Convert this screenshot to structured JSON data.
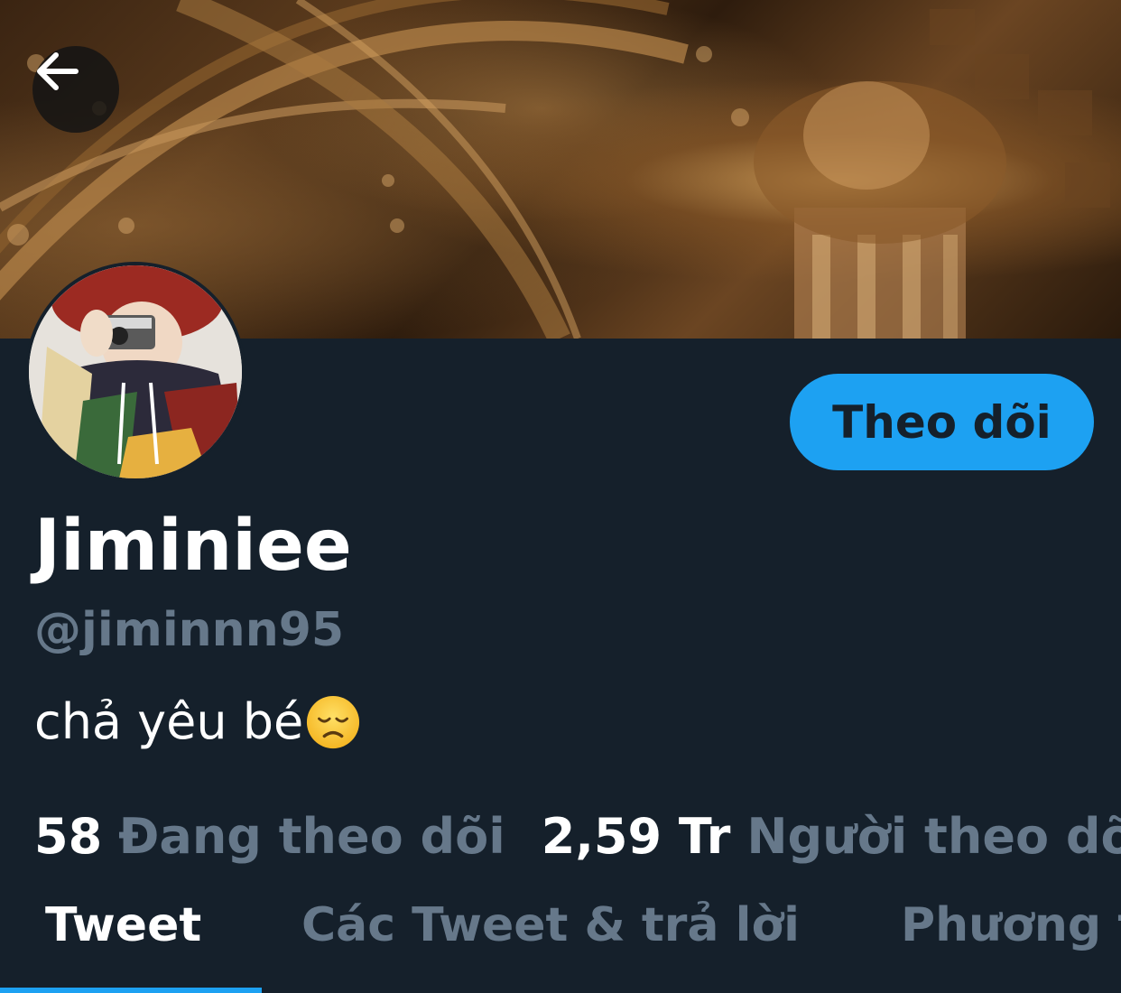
{
  "header": {
    "back_icon": "arrow-left-icon"
  },
  "profile": {
    "display_name": "Jiminiee",
    "handle": "@jiminnn95",
    "bio": "chả yêu bé",
    "bio_emoji": "disappointed-face-emoji",
    "follow_button_label": "Theo dõi"
  },
  "stats": {
    "following_count": "58",
    "following_label": "Đang theo dõi",
    "followers_count": "2,59 Tr",
    "followers_label": "Người theo dõi"
  },
  "tabs": [
    {
      "label": "Tweet",
      "active": true
    },
    {
      "label": "Các Tweet & trả lời",
      "active": false
    },
    {
      "label": "Phương tiện",
      "active": false
    }
  ],
  "colors": {
    "background": "#15202b",
    "accent": "#1da1f2",
    "secondary_text": "#66788a",
    "primary_text": "#ffffff"
  }
}
